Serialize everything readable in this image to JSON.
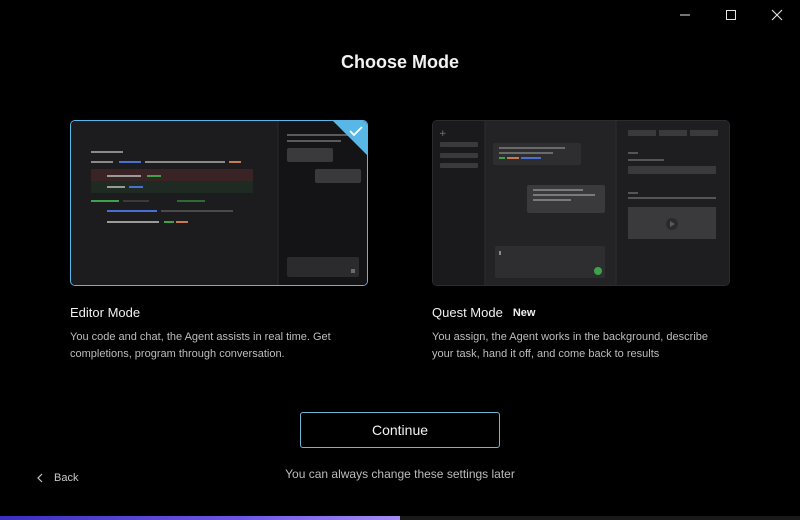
{
  "window": {
    "controls": [
      "minimize-icon",
      "maximize-icon",
      "close-icon"
    ]
  },
  "title": "Choose Mode",
  "modes": [
    {
      "name": "Editor Mode",
      "badge": "",
      "description": "You code and chat, the Agent assists in real time. Get completions, program through conversation.",
      "selected": true
    },
    {
      "name": "Quest Mode",
      "badge": "New",
      "description": "You assign, the Agent works in the background, describe your task, hand it off, and come back to results",
      "selected": false
    }
  ],
  "continue_label": "Continue",
  "back_label": "Back",
  "hint": "You can always change these settings later",
  "progress": 0.5,
  "colors": {
    "accent": "#58b7e6",
    "continue_border": "#6fb6d4",
    "progress_start": "#3a2fbf",
    "progress_end": "#a58cf5"
  }
}
